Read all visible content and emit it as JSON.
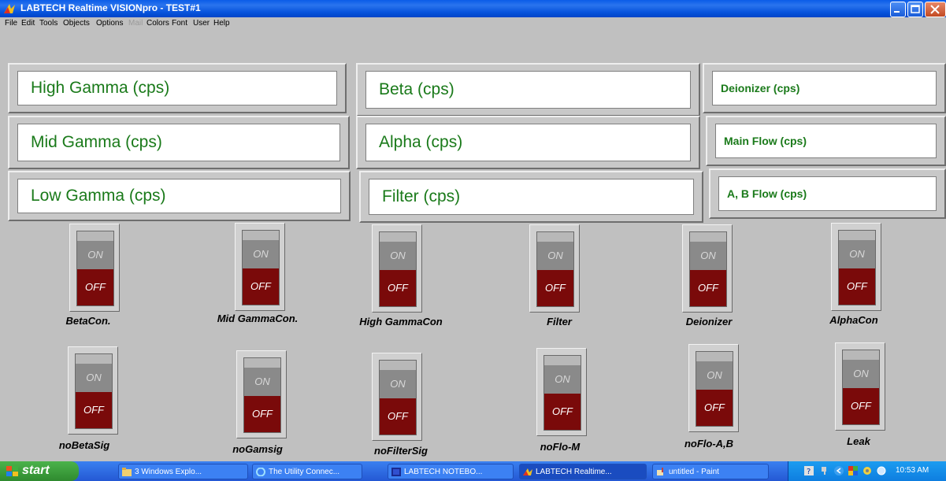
{
  "window": {
    "title": "LABTECH Realtime VISIONpro - TEST#1"
  },
  "menu": [
    "File",
    "Edit",
    "Tools",
    "Objects",
    "Options",
    "Mail",
    "Colors",
    "Font",
    "User",
    "Help"
  ],
  "panels": {
    "high_gamma": "High Gamma (cps)",
    "mid_gamma": "Mid Gamma (cps)",
    "low_gamma": "Low Gamma (cps)",
    "beta": "Beta (cps)",
    "alpha": "Alpha (cps)",
    "filter": "Filter (cps)",
    "deionizer": "Deionizer (cps)",
    "main_flow": "Main Flow (cps)",
    "ab_flow": "A, B Flow (cps)"
  },
  "switch_states": {
    "on": "ON",
    "off": "OFF"
  },
  "switches_row1": [
    "BetaCon.",
    "Mid GammaCon.",
    "High GammaCon",
    "Filter",
    "Deionizer",
    "AlphaCon"
  ],
  "switches_row2": [
    "noBetaSig",
    "noGamsig",
    "noFilterSig",
    "noFlo-M",
    "noFlo-A,B",
    "Leak"
  ],
  "taskbar": {
    "start": "start",
    "items": [
      "3 Windows Explo...",
      "The Utility Connec...",
      "LABTECH NOTEBO...",
      "LABTECH Realtime...",
      "untitled - Paint"
    ],
    "clock": "10:53 AM"
  },
  "colors": {
    "label_green": "#1a7a1a",
    "switch_off": "#7a0a0a",
    "background": "#c0c0c0"
  }
}
